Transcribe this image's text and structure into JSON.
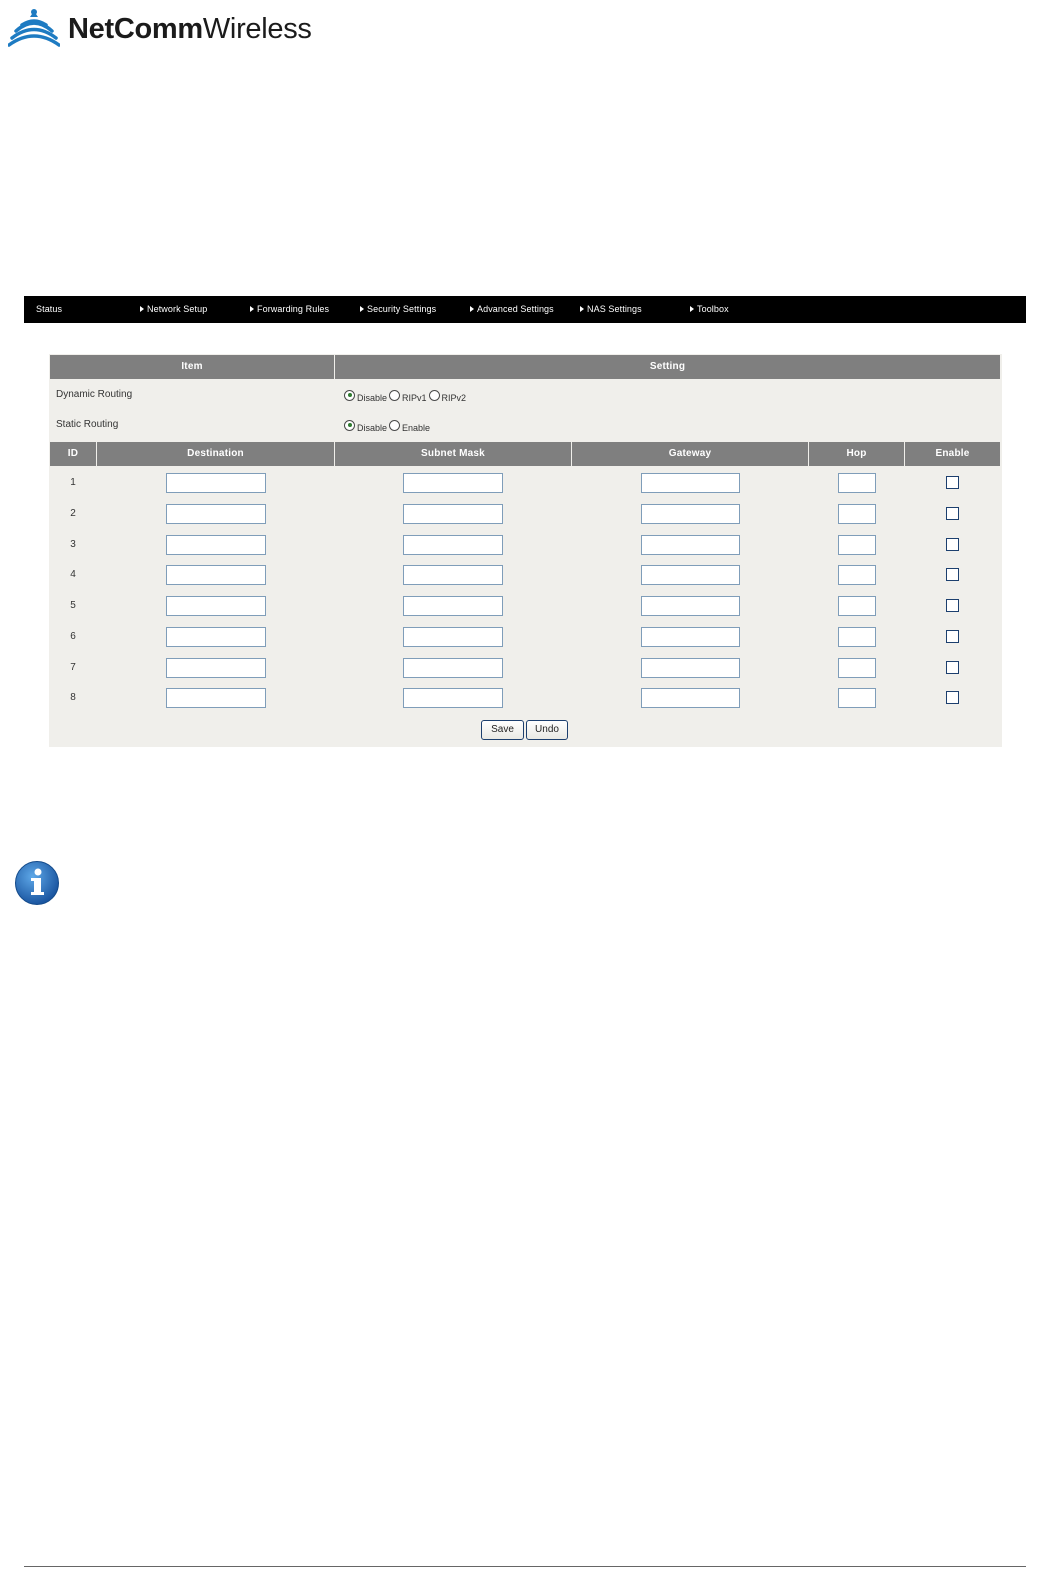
{
  "logo": {
    "bold": "NetComm",
    "light": "Wireless"
  },
  "nav": {
    "items": [
      {
        "label": "Status",
        "arrow": false
      },
      {
        "label": "Network Setup",
        "arrow": true
      },
      {
        "label": "Forwarding Rules",
        "arrow": true
      },
      {
        "label": "Security Settings",
        "arrow": true
      },
      {
        "label": "Advanced Settings",
        "arrow": true
      },
      {
        "label": "NAS Settings",
        "arrow": true
      },
      {
        "label": "Toolbox",
        "arrow": true
      }
    ]
  },
  "table": {
    "header": {
      "item": "Item",
      "setting": "Setting"
    },
    "dynamic_routing": {
      "label": "Dynamic Routing",
      "options": [
        "Disable",
        "RIPv1",
        "RIPv2"
      ],
      "selected": "Disable"
    },
    "static_routing": {
      "label": "Static Routing",
      "options": [
        "Disable",
        "Enable"
      ],
      "selected": "Disable"
    },
    "columns": {
      "id": "ID",
      "destination": "Destination",
      "subnet_mask": "Subnet Mask",
      "gateway": "Gateway",
      "hop": "Hop",
      "enable": "Enable"
    },
    "rows": [
      {
        "id": "1",
        "destination": "",
        "subnet_mask": "",
        "gateway": "",
        "hop": "",
        "enabled": false
      },
      {
        "id": "2",
        "destination": "",
        "subnet_mask": "",
        "gateway": "",
        "hop": "",
        "enabled": false
      },
      {
        "id": "3",
        "destination": "",
        "subnet_mask": "",
        "gateway": "",
        "hop": "",
        "enabled": false
      },
      {
        "id": "4",
        "destination": "",
        "subnet_mask": "",
        "gateway": "",
        "hop": "",
        "enabled": false
      },
      {
        "id": "5",
        "destination": "",
        "subnet_mask": "",
        "gateway": "",
        "hop": "",
        "enabled": false
      },
      {
        "id": "6",
        "destination": "",
        "subnet_mask": "",
        "gateway": "",
        "hop": "",
        "enabled": false
      },
      {
        "id": "7",
        "destination": "",
        "subnet_mask": "",
        "gateway": "",
        "hop": "",
        "enabled": false
      },
      {
        "id": "8",
        "destination": "",
        "subnet_mask": "",
        "gateway": "",
        "hop": "",
        "enabled": false
      }
    ]
  },
  "actions": {
    "save": "Save",
    "undo": "Undo"
  },
  "icons": {
    "logo": "wifi-tower-icon",
    "info": "info-icon",
    "nav_arrow": "triangle-right-icon"
  },
  "colors": {
    "navbar": "#000000",
    "header": "#7f7f7f",
    "panel": "#f0efeb",
    "logo_blue": "#1e7bc2",
    "info_blue": "#1f66b0"
  }
}
